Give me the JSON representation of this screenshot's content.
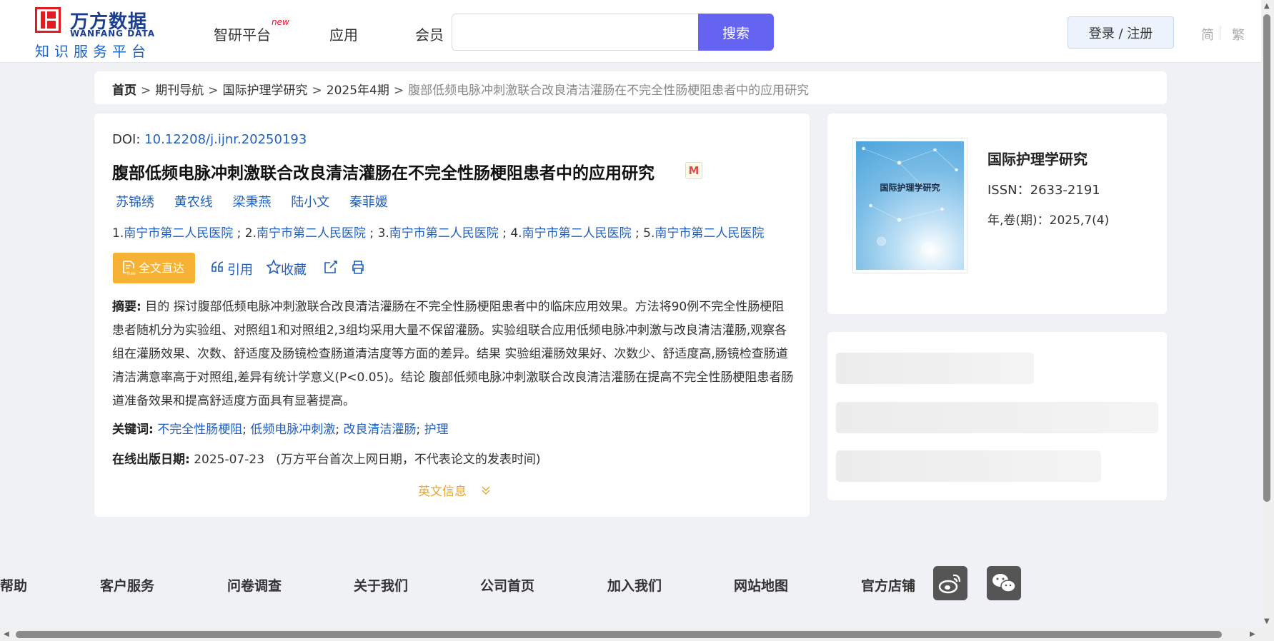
{
  "header": {
    "logo": {
      "name_cn": "万方数据",
      "name_en": "WANFANG DATA",
      "subtitle": "知识服务平台",
      "brand_color": "#1c3e8f"
    },
    "nav": [
      {
        "label": "智研平台",
        "badge": "new"
      },
      {
        "label": "应用"
      },
      {
        "label": "会员"
      }
    ],
    "search": {
      "value": "",
      "placeholder": "",
      "button_label": "搜索",
      "button_color": "#6463f2"
    },
    "login_label": "登录 / 注册",
    "lang": {
      "simplified": "简",
      "traditional": "繁"
    }
  },
  "breadcrumb": {
    "items": [
      "首页",
      "期刊导航",
      "国际护理学研究",
      "2025年4期"
    ],
    "separator": ">",
    "current": "腹部低频电脉冲刺激联合改良清洁灌肠在不完全性肠梗阻患者中的应用研究"
  },
  "article": {
    "doi_label": "DOI:",
    "doi": "10.12208/j.ijnr.20250193",
    "title": "腹部低频电脉冲刺激联合改良清洁灌肠在不完全性肠梗阻患者中的应用研究",
    "title_badge": "M",
    "authors": [
      "苏锦绣",
      "黄农线",
      "梁秉燕",
      "陆小文",
      "秦菲媛"
    ],
    "affiliations": [
      {
        "num": "1.",
        "name": "南宁市第二人民医院"
      },
      {
        "num": "2.",
        "name": "南宁市第二人民医院"
      },
      {
        "num": "3.",
        "name": "南宁市第二人民医院"
      },
      {
        "num": "4.",
        "name": "南宁市第二人民医院"
      },
      {
        "num": "5.",
        "name": "南宁市第二人民医院"
      }
    ],
    "actions": {
      "fulltext": "全文直达",
      "fulltext_icon_text": "free",
      "cite": "引用",
      "favorite": "收藏"
    },
    "abstract_label": "摘要:",
    "abstract": "目的 探讨腹部低频电脉冲刺激联合改良清洁灌肠在不完全性肠梗阻患者中的临床应用效果。方法将90例不完全性肠梗阻患者随机分为实验组、对照组1和对照组2,3组均采用大量不保留灌肠。实验组联合应用低频电脉冲刺激与改良清洁灌肠,观察各组在灌肠效果、次数、舒适度及肠镜检查肠道清洁度等方面的差异。结果 实验组灌肠效果好、次数少、舒适度高,肠镜检查肠道清洁满意率高于对照组,差异有统计学意义(P<0.05)。结论 腹部低频电脉冲刺激联合改良清洁灌肠在提高不完全性肠梗阻患者肠道准备效果和提高舒适度方面具有显著提高。",
    "keywords_label": "关键词:",
    "keywords": [
      "不完全性肠梗阻",
      "低频电脉冲刺激",
      "改良清洁灌肠",
      "护理"
    ],
    "pubdate_label": "在线出版日期:",
    "pubdate": "2025-07-23",
    "pubdate_note": "(万方平台首次上网日期，不代表论文的发表时间)",
    "english_info": "英文信息"
  },
  "journal": {
    "cover_title": "国际护理学研究",
    "name": "国际护理学研究",
    "issn": "ISSN：2633-2191",
    "volume": "年,卷(期)：2025,7(4)"
  },
  "footer": {
    "links": [
      "帮助",
      "客户服务",
      "问卷调查",
      "关于我们",
      "公司首页",
      "加入我们",
      "网站地图",
      "官方店铺"
    ],
    "social": [
      "weibo-icon",
      "wechat-icon"
    ]
  }
}
